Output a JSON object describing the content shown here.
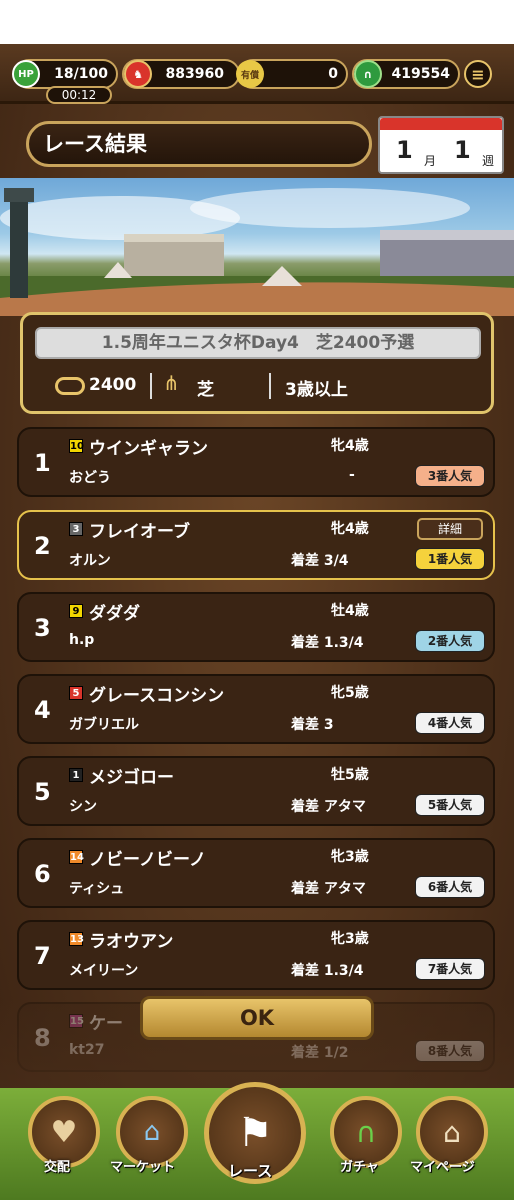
{
  "header": {
    "stamina": "18/100",
    "timer": "00:12",
    "gold": "883960",
    "tickets": "0",
    "coins": "419554",
    "hp_label": "HP",
    "ticket_label": "有償"
  },
  "title": "レース結果",
  "calendar": {
    "month": "1",
    "month_unit": "月",
    "week": "1",
    "week_unit": "週"
  },
  "race": {
    "name": "1.5周年ユニスタ杯Day4　芝2400予選",
    "distance": "2400",
    "surface": "芝",
    "condition": "3歳以上"
  },
  "results": [
    {
      "rank": "1",
      "gate": "10",
      "gate_color": "#f2d600",
      "name": "ウインギャラン",
      "owner": "おどう",
      "sexage": "牝4歳",
      "margin": "-",
      "popularity": "3番人気",
      "pop_color": "#f5b08a"
    },
    {
      "rank": "2",
      "gate": "3",
      "gate_color": "#666666",
      "name": "フレイオーブ",
      "owner": "オルン",
      "sexage": "牝4歳",
      "margin": "着差 3/4",
      "popularity": "1番人気",
      "pop_color": "#f5d23c",
      "detail": "詳細"
    },
    {
      "rank": "3",
      "gate": "9",
      "gate_color": "#f2d600",
      "name": "ダダダ",
      "owner": "h.p",
      "sexage": "牡4歳",
      "margin": "着差 1.3/4",
      "popularity": "2番人気",
      "pop_color": "#9fd4e6"
    },
    {
      "rank": "4",
      "gate": "5",
      "gate_color": "#d9342b",
      "name": "グレースコンシン",
      "owner": "ガブリエル",
      "sexage": "牝5歳",
      "margin": "着差 3",
      "popularity": "4番人気",
      "pop_color": "#f2f2f2"
    },
    {
      "rank": "5",
      "gate": "1",
      "gate_color": "#222222",
      "name": "メジゴロー",
      "owner": "シン",
      "sexage": "牡5歳",
      "margin": "着差 アタマ",
      "popularity": "5番人気",
      "pop_color": "#f2f2f2"
    },
    {
      "rank": "6",
      "gate": "14",
      "gate_color": "#f08a2a",
      "name": "ノビーノビーノ",
      "owner": "ティシュ",
      "sexage": "牝3歳",
      "margin": "着差 アタマ",
      "popularity": "6番人気",
      "pop_color": "#f2f2f2"
    },
    {
      "rank": "7",
      "gate": "13",
      "gate_color": "#f08a2a",
      "name": "ラオウアン",
      "owner": "メイリーン",
      "sexage": "牝3歳",
      "margin": "着差 1.3/4",
      "popularity": "7番人気",
      "pop_color": "#f2f2f2"
    },
    {
      "rank": "8",
      "gate": "15",
      "gate_color": "#c040a0",
      "name": "ケー",
      "owner": "kt27",
      "sexage": "",
      "margin": "着差 1/2",
      "popularity": "8番人気",
      "pop_color": "#f2f2f2"
    }
  ],
  "ok_label": "OK",
  "nav": [
    {
      "label": "交配",
      "icon": "breeding-icon"
    },
    {
      "label": "マーケット",
      "icon": "market-icon"
    },
    {
      "label": "レース",
      "icon": "race-flag-icon"
    },
    {
      "label": "ガチャ",
      "icon": "gacha-icon"
    },
    {
      "label": "マイページ",
      "icon": "home-icon"
    }
  ]
}
